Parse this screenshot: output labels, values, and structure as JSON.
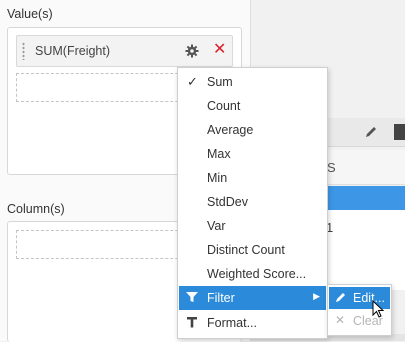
{
  "values_section": {
    "label": "Value(s)",
    "field_chip": {
      "label": "SUM(Freight)",
      "settings_icon": "gear-icon",
      "remove_icon": "close-icon"
    }
  },
  "columns_section": {
    "label": "Column(s)"
  },
  "background_grid": {
    "header_fragment": "S",
    "cell_fragment": "1"
  },
  "aggregate_menu": {
    "items": [
      {
        "label": "Sum",
        "checked": true
      },
      {
        "label": "Count"
      },
      {
        "label": "Average"
      },
      {
        "label": "Max"
      },
      {
        "label": "Min"
      },
      {
        "label": "StdDev"
      },
      {
        "label": "Var"
      },
      {
        "label": "Distinct Count"
      },
      {
        "label": "Weighted Score..."
      },
      {
        "label": "Filter",
        "icon": "filter-icon",
        "has_submenu": true,
        "highlighted": true
      },
      {
        "label": "Format...",
        "icon": "text-format-icon"
      }
    ]
  },
  "filter_submenu": {
    "items": [
      {
        "label": "Edit...",
        "icon": "pencil-icon",
        "highlighted": true
      },
      {
        "label": "Clear",
        "icon": "close-icon",
        "disabled": true
      }
    ]
  },
  "colors": {
    "accent": "#2b8ad9",
    "remove": "#d9202d",
    "grid_selection": "#3d97e6"
  }
}
